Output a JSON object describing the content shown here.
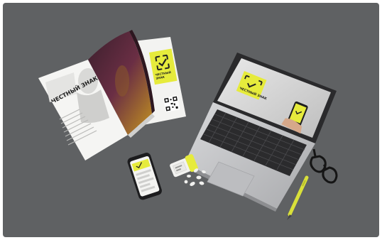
{
  "scene": {
    "brand_text": "ЧЕСТНЫЙ ЗНАК",
    "brand_line_1": "ЧЕСТНЫЙ",
    "brand_line_2": "ЗНАК",
    "colors": {
      "background": "#5f6163",
      "accent": "#e6eb3c",
      "paper": "#f2f2f0",
      "laptop_body": "#c9cacc",
      "keys": "#2b2b2d"
    },
    "objects": [
      "magazine-spread",
      "brochure-qr",
      "laptop",
      "smartphone",
      "pill-bottle",
      "pills",
      "glasses",
      "pen"
    ]
  }
}
